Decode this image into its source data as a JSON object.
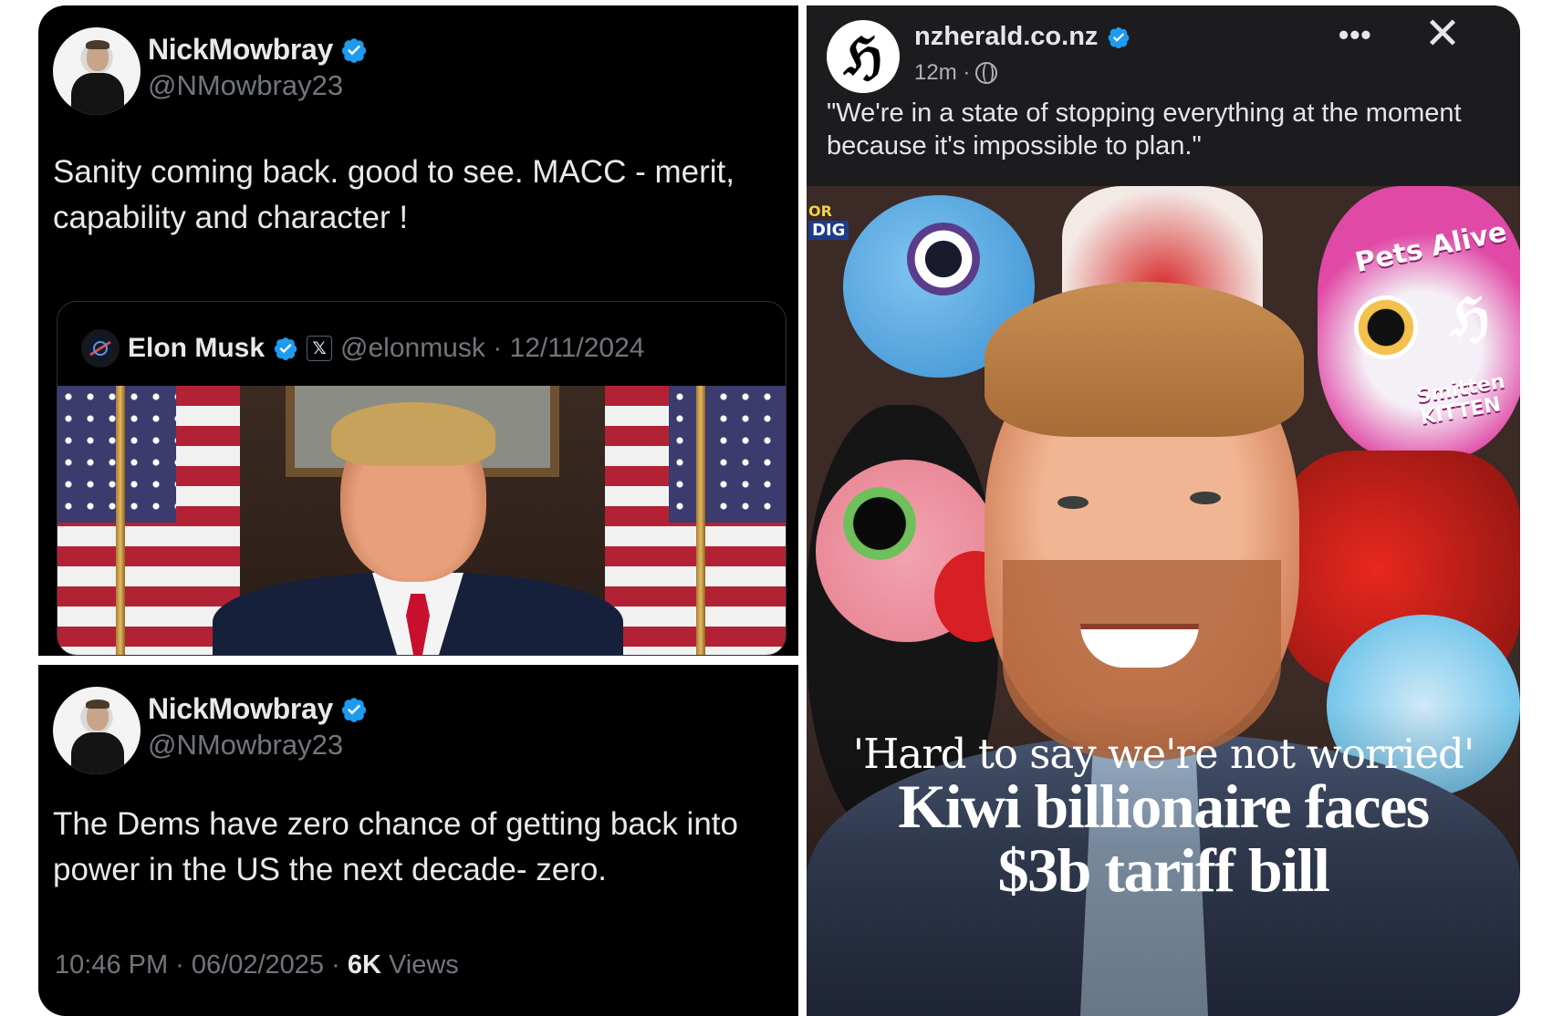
{
  "tweet1": {
    "display_name": "NickMowbray",
    "handle": "@NMowbray23",
    "text_line1": "Sanity coming back. good to see. MACC - merit,",
    "text_line2": "capability and character !"
  },
  "quote": {
    "name": "Elon Musk",
    "x_badge": "𝕏",
    "meta": "@elonmusk · 12/11/2024"
  },
  "tweet2": {
    "display_name": "NickMowbray",
    "handle": "@NMowbray23",
    "text_line1": "The Dems have zero chance of getting back into",
    "text_line2": "power in the US the next decade- zero.",
    "time": "10:46 PM · 06/02/2025 · ",
    "views_count": "6K",
    "views_label": " Views"
  },
  "fb_post": {
    "page_name": "nzherald.co.nz",
    "time": "12m ·",
    "more": "•••",
    "close": "✕",
    "logo_glyph": "ℌ",
    "caption": "\"We're in a state of stopping everything at the moment because it's impossible to plan.\"",
    "image": {
      "kicker": "'Hard to say we're not worried'",
      "headline_line1": "Kiwi billionaire faces",
      "headline_line2": "$3b tariff bill",
      "toy_tag_1": "Pets Alive",
      "toy_tag_2": "Smitten KITTEN",
      "toy_tag_3": "DIG",
      "toy_tag_4": "OR"
    }
  },
  "colors": {
    "twitter_bg": "#000000",
    "verified_blue": "#1d9bf0",
    "facebook_bg": "#1c1c1e"
  }
}
